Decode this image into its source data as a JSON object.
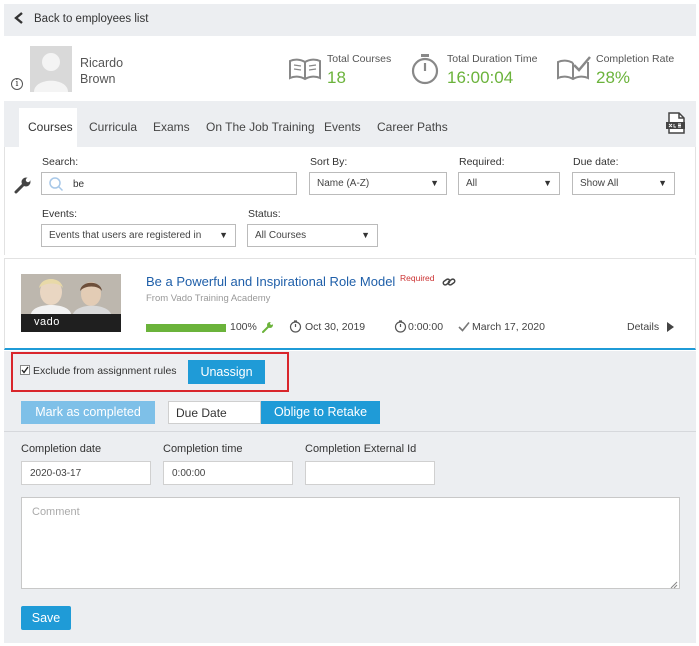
{
  "nav": {
    "back_label": "Back to employees list"
  },
  "employee": {
    "first_name": "Ricardo",
    "last_name": "Brown"
  },
  "stats": [
    {
      "label": "Total Courses",
      "value": "18",
      "icon": "book-icon"
    },
    {
      "label": "Total Duration Time",
      "value": "16:00:04",
      "icon": "stopwatch-icon"
    },
    {
      "label": "Completion Rate",
      "value": "28%",
      "icon": "book-check-icon"
    }
  ],
  "tabs": [
    "Courses",
    "Curricula",
    "Exams",
    "On The Job Training",
    "Events",
    "Career Paths"
  ],
  "filters": {
    "search_label": "Search:",
    "search_value": "be",
    "sort_label": "Sort By:",
    "sort_value": "Name (A-Z)",
    "required_label": "Required:",
    "required_value": "All",
    "due_label": "Due date:",
    "due_value": "Show All",
    "events_label": "Events:",
    "events_value": "Events that users are registered in",
    "status_label": "Status:",
    "status_value": "All Courses"
  },
  "course": {
    "title": "Be a Powerful and Inspirational Role Model",
    "required": "Required",
    "provider": "From Vado Training Academy",
    "progress": "100%",
    "progress_fraction": 1.0,
    "start_date": "Oct 30, 2019",
    "duration": "0:00:00",
    "completed_date": "March 17, 2020",
    "details_label": "Details",
    "thumb_text": "vado"
  },
  "assign": {
    "exclude_label": "Exclude from assignment rules",
    "exclude_checked": true,
    "unassign_label": "Unassign"
  },
  "actions": {
    "mark_completed": "Mark as completed",
    "due_date": "Due Date",
    "oblige_retake": "Oblige to Retake"
  },
  "completion": {
    "date_label": "Completion date",
    "date_value": "2020-03-17",
    "time_label": "Completion time",
    "time_value": "0:00:00",
    "external_label": "Completion External Id",
    "external_value": "",
    "comment_placeholder": "Comment",
    "save_label": "Save"
  },
  "colors": {
    "accent": "#1f9bd7",
    "success": "#6bb33b",
    "danger": "#d9262c",
    "panel": "#eceef1"
  }
}
